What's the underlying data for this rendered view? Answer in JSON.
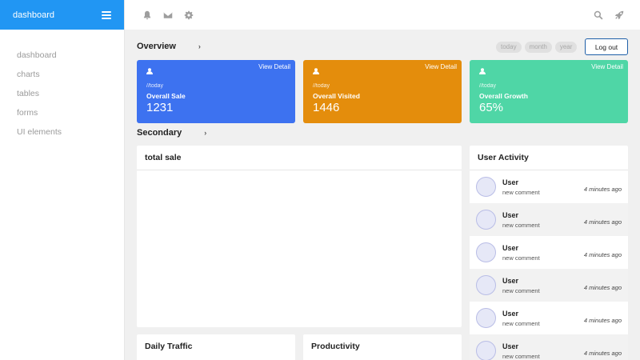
{
  "sidebar": {
    "brand": "dashboard",
    "items": [
      "dashboard",
      "charts",
      "tables",
      "forms",
      "UI elements"
    ]
  },
  "topbar": {
    "left_icons": [
      "bell-icon",
      "envelope-icon",
      "gear-icon"
    ],
    "right_icons": [
      "search-icon",
      "rocket-icon"
    ]
  },
  "overview": {
    "title": "Overview",
    "filters": [
      "today",
      "month",
      "year"
    ],
    "logout_label": "Log out"
  },
  "cards": [
    {
      "detail": "View Detail",
      "period": "//today",
      "label": "Overall Sale",
      "value": "1231",
      "color": "#3d72f0"
    },
    {
      "detail": "View Detail",
      "period": "//today",
      "label": "Overall Visited",
      "value": "1446",
      "color": "#e48d0c"
    },
    {
      "detail": "View Detail",
      "period": "//today",
      "label": "Overall Growth",
      "value": "65%",
      "color": "#4fd6a6"
    }
  ],
  "secondary": {
    "title": "Secondary"
  },
  "panels": {
    "total_sale": "total sale",
    "daily_traffic": "Daily Traffic",
    "productivity": "Productivity",
    "user_activity": "User Activity"
  },
  "activity": [
    {
      "name": "User",
      "desc": "new comment",
      "time": "4 minutes ago"
    },
    {
      "name": "User",
      "desc": "new comment",
      "time": "4 minutes ago"
    },
    {
      "name": "User",
      "desc": "new comment",
      "time": "4 minutes ago"
    },
    {
      "name": "User",
      "desc": "new comment",
      "time": "4 minutes ago"
    },
    {
      "name": "User",
      "desc": "new comment",
      "time": "4 minutes ago"
    },
    {
      "name": "User",
      "desc": "new comment",
      "time": "4 minutes ago"
    }
  ]
}
